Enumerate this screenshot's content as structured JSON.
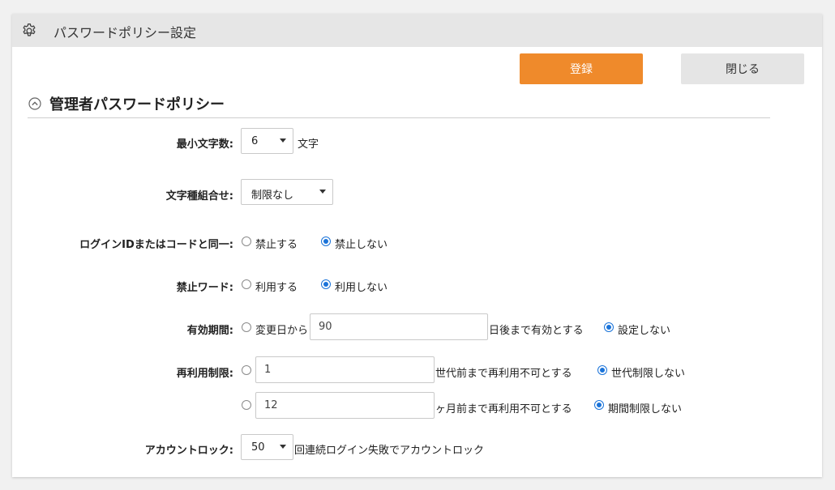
{
  "window": {
    "title": "パスワードポリシー設定",
    "icon": "gear-icon"
  },
  "toolbar": {
    "register_label": "登録",
    "close_label": "閉じる"
  },
  "colors": {
    "primary": "#ef8a2b",
    "radio_accent": "#1a73d9"
  },
  "section": {
    "title": "管理者パスワードポリシー",
    "collapse_icon": "chevron-up-circle-icon"
  },
  "form": {
    "min_length": {
      "label": "最小文字数:",
      "value": "6",
      "unit": "文字"
    },
    "char_types": {
      "label": "文字種組合せ:",
      "value": "制限なし"
    },
    "same_as_id": {
      "label": "ログインIDまたはコードと同一:",
      "option_forbid": "禁止する",
      "option_allow": "禁止しない",
      "selected": "禁止しない"
    },
    "forbidden_words": {
      "label": "禁止ワード:",
      "option_use": "利用する",
      "option_nouse": "利用しない",
      "selected": "利用しない"
    },
    "expiry": {
      "label": "有効期間:",
      "prefix": "変更日から",
      "days_value": "90",
      "suffix": "日後まで有効とする",
      "option_none": "設定しない",
      "selected": "設定しない"
    },
    "reuse": {
      "label": "再利用制限:",
      "generations_value": "1",
      "generations_suffix": "世代前まで再利用不可とする",
      "generations_none": "世代制限しない",
      "months_value": "12",
      "months_suffix": "ヶ月前まで再利用不可とする",
      "months_none": "期間制限しない"
    },
    "lockout": {
      "label": "アカウントロック:",
      "value": "50",
      "suffix": "回連続ログイン失敗でアカウントロック"
    }
  }
}
